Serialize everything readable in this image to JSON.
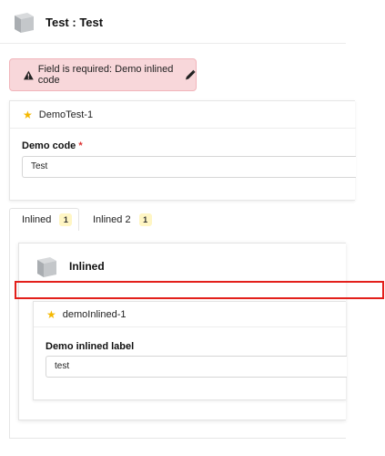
{
  "header": {
    "title": "Test : Test",
    "icon": "cube-icon"
  },
  "alert": {
    "message": "Field is required: Demo inlined code",
    "icon": "warning-icon",
    "edit_icon": "pencil-icon",
    "background": "#f8d7da"
  },
  "main_card": {
    "title": "DemoTest-1",
    "icon": "star-icon",
    "field_label": "Demo code",
    "required_mark": "*",
    "field_value": "Test"
  },
  "tabs": [
    {
      "label": "Inlined",
      "count": "1",
      "active": true
    },
    {
      "label": "Inlined 2",
      "count": "1",
      "active": false
    }
  ],
  "inlined": {
    "title": "Inlined",
    "icon": "cube-icon",
    "sub_card": {
      "title": "demoInlined-1",
      "icon": "star-icon",
      "field_label": "Demo inlined label",
      "field_value": "test"
    }
  },
  "colors": {
    "accent_star": "#f5b800",
    "badge": "#fff6c4",
    "highlight": "#e3201b"
  }
}
